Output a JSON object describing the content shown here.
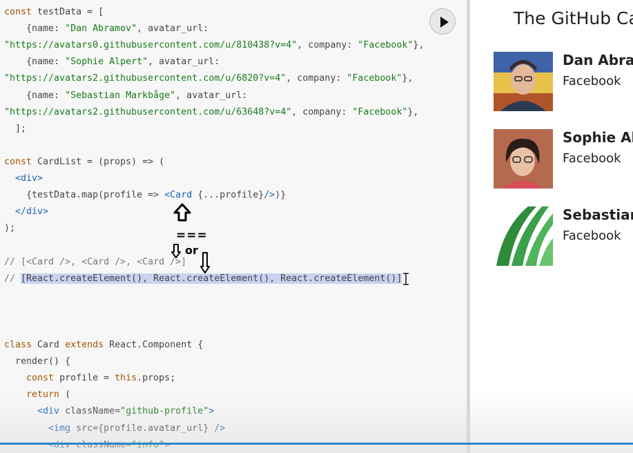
{
  "editor": {
    "lines": [
      [
        [
          "k",
          "const"
        ],
        [
          "p",
          " testData = ["
        ]
      ],
      [
        [
          "p",
          "    {name: "
        ],
        [
          "s",
          "\"Dan Abramov\""
        ],
        [
          "p",
          ", avatar_url:"
        ]
      ],
      [
        [
          "s",
          "\"https://avatars0.githubusercontent.com/u/810438?v=4\""
        ],
        [
          "p",
          ", company: "
        ],
        [
          "s",
          "\"Facebook\""
        ],
        [
          "p",
          "},"
        ]
      ],
      [
        [
          "p",
          "    {name: "
        ],
        [
          "s",
          "\"Sophie Alpert\""
        ],
        [
          "p",
          ", avatar_url:"
        ]
      ],
      [
        [
          "s",
          "\"https://avatars2.githubusercontent.com/u/6820?v=4\""
        ],
        [
          "p",
          ", company: "
        ],
        [
          "s",
          "\"Facebook\""
        ],
        [
          "p",
          "},"
        ]
      ],
      [
        [
          "p",
          "    {name: "
        ],
        [
          "s",
          "\"Sebastian Markbåge\""
        ],
        [
          "p",
          ", avatar_url:"
        ]
      ],
      [
        [
          "s",
          "\"https://avatars2.githubusercontent.com/u/63648?v=4\""
        ],
        [
          "p",
          ", company: "
        ],
        [
          "s",
          "\"Facebook\""
        ],
        [
          "p",
          "},"
        ]
      ],
      [
        [
          "p",
          "  ];"
        ]
      ],
      [],
      [
        [
          "k",
          "const"
        ],
        [
          "p",
          " CardList = (props) => ("
        ]
      ],
      [
        [
          "t",
          "  <div>"
        ]
      ],
      [
        [
          "p",
          "    {testData.map(profile => "
        ],
        [
          "t",
          "<Card"
        ],
        [
          "p",
          " {...profile}"
        ],
        [
          "t",
          "/>"
        ],
        [
          "p",
          ")}"
        ]
      ],
      [
        [
          "t",
          "  </div>"
        ]
      ],
      [
        [
          "p",
          ");"
        ]
      ],
      [],
      [
        [
          "c",
          "// [<Card />, <Card />, <Card />]"
        ]
      ],
      [
        [
          "c",
          "// "
        ],
        [
          "hl",
          "[React.createElement(), React.createElement(), React.createElement()]"
        ]
      ],
      [],
      [],
      [],
      [
        [
          "k",
          "class"
        ],
        [
          "p",
          " Card "
        ],
        [
          "k",
          "extends"
        ],
        [
          "p",
          " React.Component {"
        ]
      ],
      [
        [
          "p",
          "  render() {"
        ]
      ],
      [
        [
          "k",
          "    const"
        ],
        [
          "p",
          " profile = "
        ],
        [
          "k",
          "this"
        ],
        [
          "p",
          ".props;"
        ]
      ],
      [
        [
          "k",
          "    return"
        ],
        [
          "p",
          " ("
        ]
      ],
      [
        [
          "t",
          "      <div"
        ],
        [
          "p",
          " className="
        ],
        [
          "s",
          "\"github-profile\""
        ],
        [
          "t",
          ">"
        ]
      ],
      [
        [
          "t",
          "        <img"
        ],
        [
          "p",
          " src={profile.avatar_url} "
        ],
        [
          "t",
          "/>"
        ]
      ],
      [
        [
          "t",
          "        <div"
        ],
        [
          "p",
          " className="
        ],
        [
          "s",
          "\"info\""
        ],
        [
          "t",
          ">"
        ]
      ]
    ],
    "run_label": "Run",
    "annotations": {
      "equals": "===",
      "or": "or"
    }
  },
  "preview": {
    "title": "The GitHub Cards App",
    "cards": [
      {
        "name": "Dan Abramov",
        "company": "Facebook"
      },
      {
        "name": "Sophie Alpert",
        "company": "Facebook"
      },
      {
        "name": "Sebastian Markbåge",
        "company": "Facebook"
      }
    ]
  }
}
